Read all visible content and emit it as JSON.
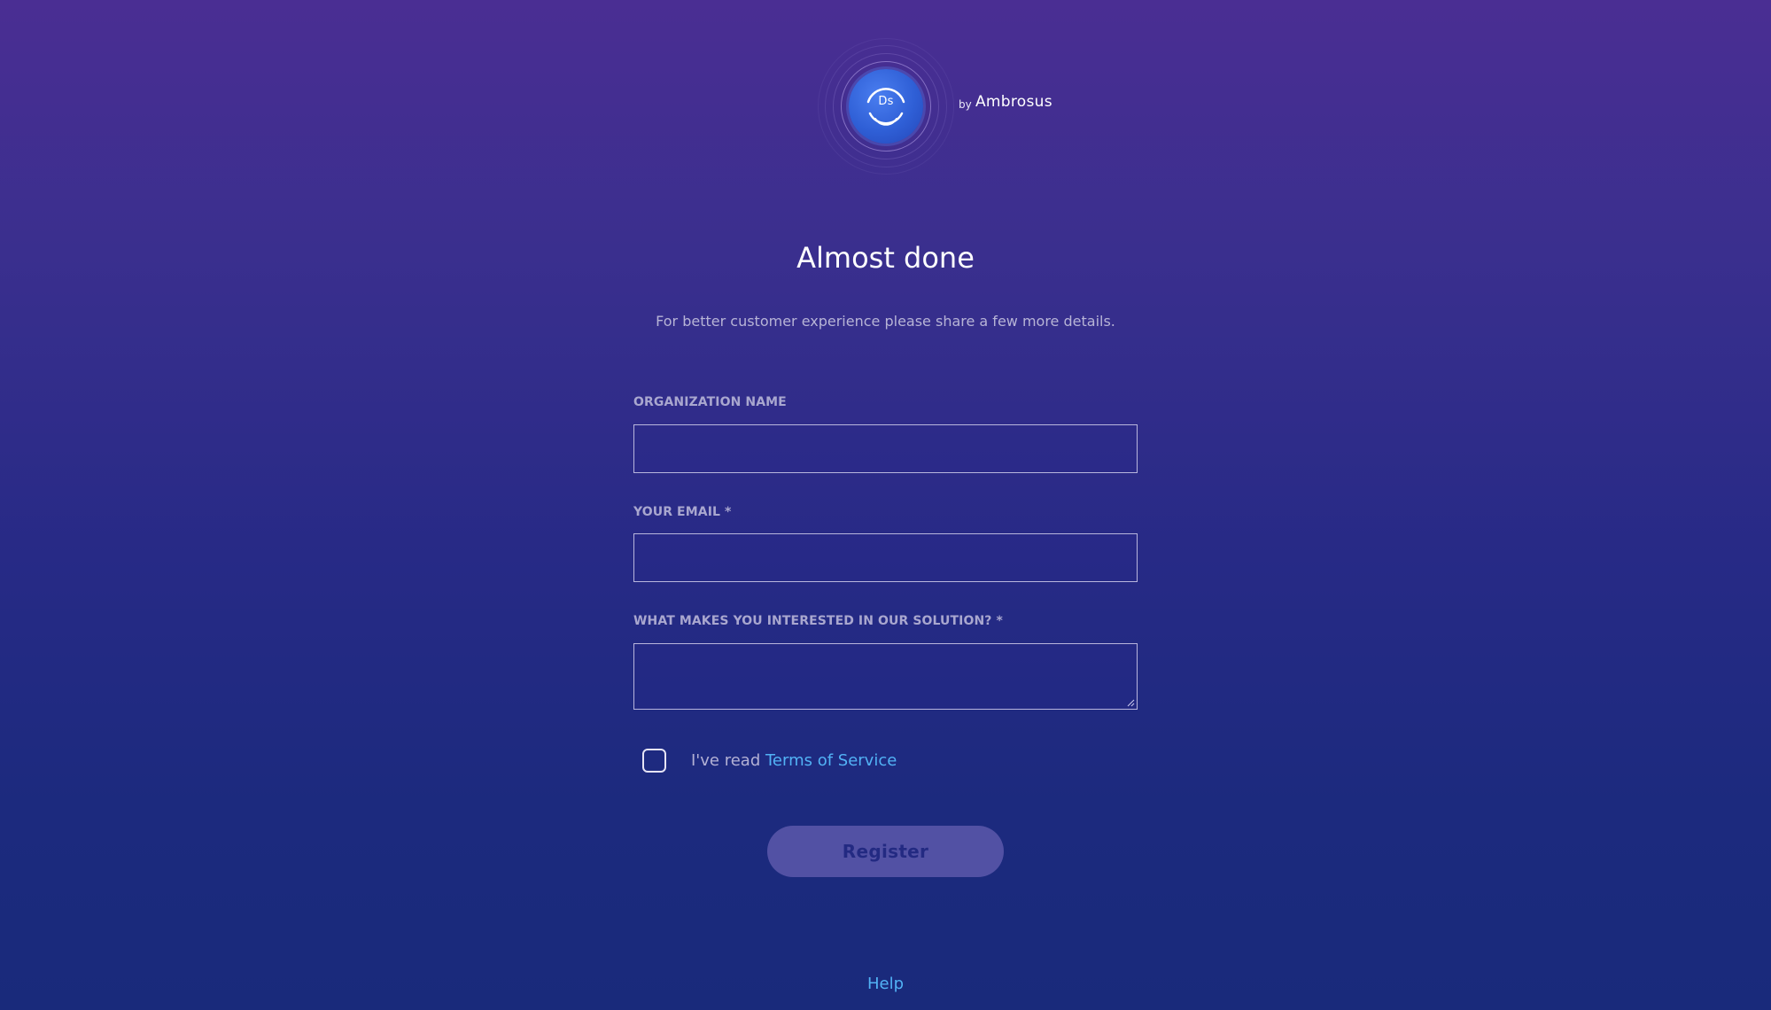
{
  "brand": {
    "logo_text": "Ds",
    "by_text": "by",
    "company_name": "Ambrosus"
  },
  "header": {
    "title": "Almost done",
    "subtitle": "For better customer experience please share a few more details."
  },
  "form": {
    "organization": {
      "label": "ORGANIZATION NAME",
      "value": ""
    },
    "email": {
      "label": "YOUR EMAIL *",
      "value": ""
    },
    "interest": {
      "label": "WHAT MAKES YOU INTERESTED IN OUR SOLUTION? *",
      "value": ""
    },
    "terms": {
      "prefix": "I've read",
      "link_label": "Terms of Service",
      "checked": false
    },
    "submit_label": "Register"
  },
  "footer": {
    "help_label": "Help"
  },
  "colors": {
    "background_top": "#4a2e93",
    "background_bottom": "#192a7b",
    "link": "#52b2f5",
    "button_bg": "#5251a4",
    "button_text": "#232a82",
    "logo_blue": "#2f5fd6"
  },
  "icons": {
    "logo": "ds-logo-icon",
    "checkbox": "checkbox-unchecked",
    "resize": "resize-grip-icon"
  }
}
